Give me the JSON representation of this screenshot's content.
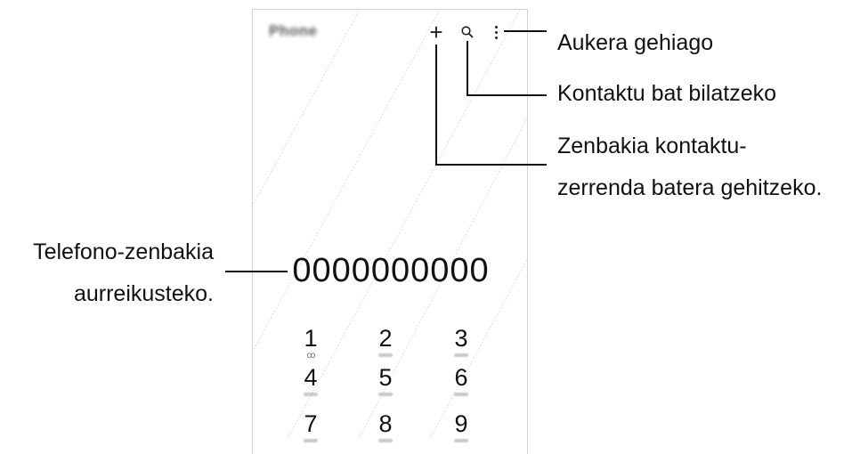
{
  "app": {
    "title": "Phone",
    "number": "0000000000"
  },
  "toolbar": {
    "add_icon": "plus-icon",
    "search_icon": "search-icon",
    "more_icon": "more-vertical-icon"
  },
  "keypad": [
    {
      "digit": "1",
      "sub": "ꝏ"
    },
    {
      "digit": "2",
      "sub": ""
    },
    {
      "digit": "3",
      "sub": ""
    },
    {
      "digit": "4",
      "sub": ""
    },
    {
      "digit": "5",
      "sub": ""
    },
    {
      "digit": "6",
      "sub": ""
    },
    {
      "digit": "7",
      "sub": ""
    },
    {
      "digit": "8",
      "sub": ""
    },
    {
      "digit": "9",
      "sub": ""
    }
  ],
  "annotations": {
    "more_options": "Aukera gehiago",
    "search_contact": "Kontaktu bat bilatzeko",
    "add_number_line1": "Zenbakia kontaktu-",
    "add_number_line2": "zerrenda batera gehitzeko.",
    "preview_line1": "Telefono-zenbakia",
    "preview_line2": "aurreikusteko."
  }
}
